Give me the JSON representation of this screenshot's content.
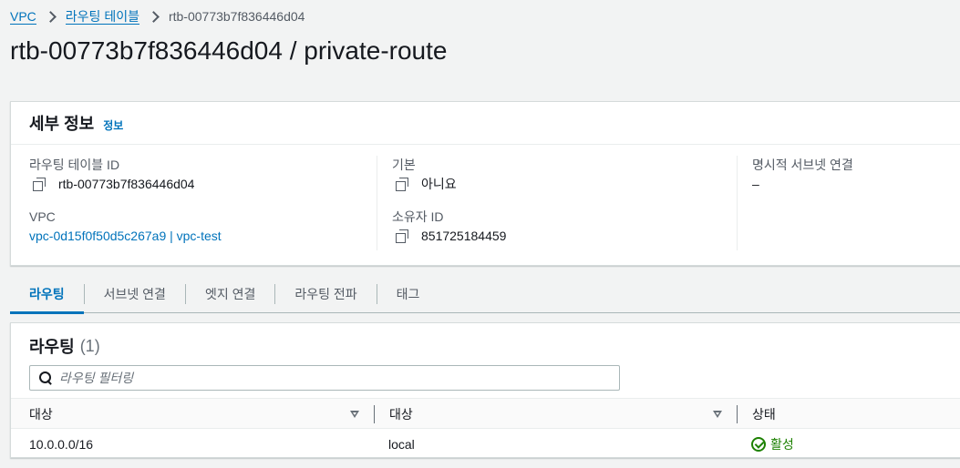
{
  "breadcrumb": {
    "items": [
      "VPC",
      "라우팅 테이블"
    ],
    "current": "rtb-00773b7f836446d04"
  },
  "page_title": "rtb-00773b7f836446d04 / private-route",
  "details": {
    "title": "세부 정보",
    "info_link": "정보",
    "route_table_id_label": "라우팅 테이블 ID",
    "route_table_id_value": "rtb-00773b7f836446d04",
    "vpc_label": "VPC",
    "vpc_value": "vpc-0d15f0f50d5c267a9 | vpc-test",
    "main_label": "기본",
    "main_value": "아니요",
    "owner_label": "소유자 ID",
    "owner_value": "851725184459",
    "explicit_subnet_label": "명시적 서브넷 연결",
    "explicit_subnet_value": "–"
  },
  "tabs": [
    {
      "label": "라우팅",
      "active": true
    },
    {
      "label": "서브넷 연결",
      "active": false
    },
    {
      "label": "엣지 연결",
      "active": false
    },
    {
      "label": "라우팅 전파",
      "active": false
    },
    {
      "label": "태그",
      "active": false
    }
  ],
  "routes": {
    "title": "라우팅",
    "count": "(1)",
    "filter_placeholder": "라우팅 필터링",
    "columns": [
      "대상",
      "대상",
      "상태"
    ],
    "rows": [
      {
        "destination": "10.0.0.0/16",
        "target": "local",
        "status": "활성"
      }
    ]
  },
  "colors": {
    "link": "#0073bb",
    "active_status": "#1d8102",
    "background": "#f2f3f3"
  }
}
